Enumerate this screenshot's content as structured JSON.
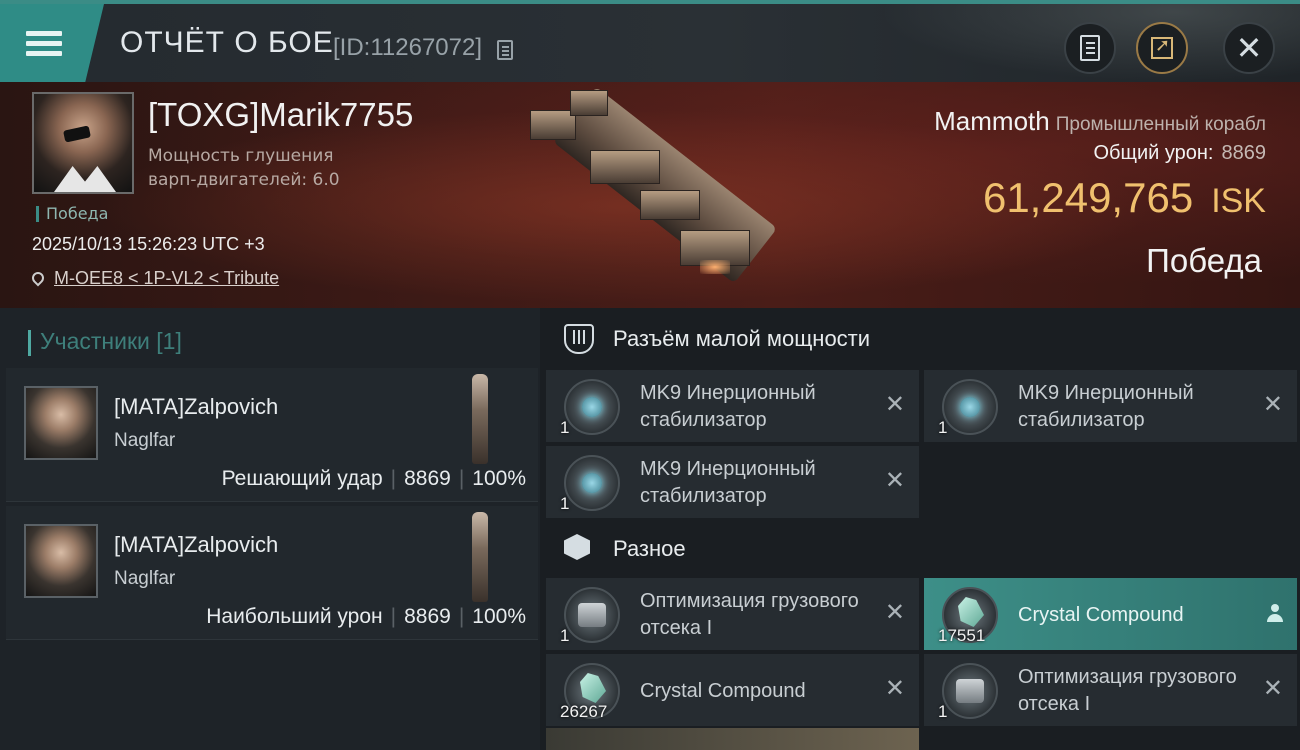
{
  "header": {
    "title": "ОТЧЁТ О БОЕ",
    "report_id": "[ID:11267072]",
    "icons": [
      "menu-icon",
      "copy-icon",
      "report-icon",
      "share-icon",
      "close-icon"
    ],
    "close_glyph": "✕"
  },
  "victim": {
    "name": "[TOXG]Marik7755",
    "stat": "Мощность глушения варп-двигателей: 6.0",
    "result_tag": "Победа",
    "datetime": "2025/10/13 15:26:23 UTC +3",
    "location": "M-OEE8 < 1P-VL2 < Tribute",
    "ship_name": "Mammoth",
    "ship_class": "Промышленный корабл",
    "total_damage_label": "Общий урон:",
    "total_damage": "8869",
    "isk_value": "61,249,765",
    "isk_unit": "ISK",
    "result_big": "Победа"
  },
  "participants": {
    "title": "Участники [1]",
    "cards": [
      {
        "name": "[MATA]Zalpovich",
        "ship": "Naglfar",
        "role": "Решающий удар",
        "damage": "8869",
        "percent": "100%"
      },
      {
        "name": "[MATA]Zalpovich",
        "ship": "Naglfar",
        "role": "Наибольший урон",
        "damage": "8869",
        "percent": "100%"
      }
    ]
  },
  "sections": {
    "low_slots": {
      "title": "Разъём малой мощности",
      "items": [
        {
          "qty": "1",
          "name": "MK9 Инерционный стабилизатор",
          "status": "destroyed"
        },
        {
          "qty": "1",
          "name": "MK9 Инерционный стабилизатор",
          "status": "destroyed"
        },
        {
          "qty": "1",
          "name": "MK9 Инерционный стабилизатор",
          "status": "destroyed"
        }
      ]
    },
    "misc": {
      "title": "Разное",
      "items": [
        {
          "qty": "1",
          "name": "Оптимизация грузового отсека I",
          "status": "destroyed"
        },
        {
          "qty": "17551",
          "name": "Crystal Compound",
          "status": "dropped"
        },
        {
          "qty": "26267",
          "name": "Crystal Compound",
          "status": "destroyed"
        },
        {
          "qty": "1",
          "name": "Оптимизация грузового отсека I",
          "status": "destroyed"
        }
      ]
    }
  },
  "glyphs": {
    "destroyed": "✕"
  },
  "colors": {
    "accent": "#3b8c86",
    "isk": "#f0c06e",
    "hero_bg": "#3e1a16"
  }
}
